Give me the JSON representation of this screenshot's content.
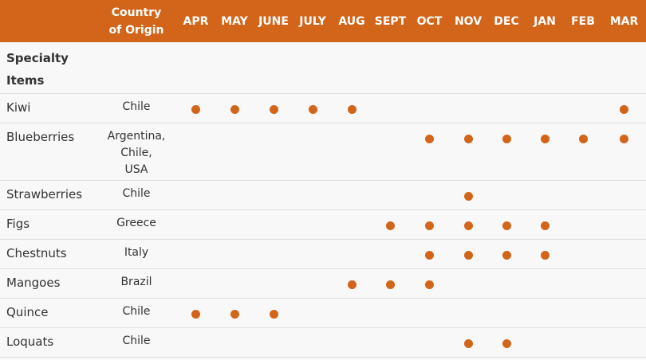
{
  "header": {
    "col1": "",
    "origin_label_line1": "Country",
    "origin_label_line2": "of Origin",
    "months": [
      "APR",
      "MAY",
      "JUNE",
      "JULY",
      "AUG",
      "SEPT",
      "OCT",
      "NOV",
      "DEC",
      "JAN",
      "FEB",
      "MAR"
    ]
  },
  "section": {
    "label_line1": "Specialty",
    "label_line2": "Items"
  },
  "colors": {
    "accent": "#d2651a"
  },
  "rows": [
    {
      "name": "Kiwi",
      "origin": [
        "Chile"
      ],
      "months": [
        "APR",
        "MAY",
        "JUNE",
        "JULY",
        "AUG",
        "MAR"
      ]
    },
    {
      "name": "Blueberries",
      "origin": [
        "Argentina,",
        "Chile,",
        "USA"
      ],
      "months": [
        "OCT",
        "NOV",
        "DEC",
        "JAN",
        "FEB",
        "MAR"
      ]
    },
    {
      "name": "Strawberries",
      "origin": [
        "Chile"
      ],
      "months": [
        "NOV"
      ]
    },
    {
      "name": "Figs",
      "origin": [
        "Greece"
      ],
      "months": [
        "SEPT",
        "OCT",
        "NOV",
        "DEC",
        "JAN"
      ]
    },
    {
      "name": "Chestnuts",
      "origin": [
        "Italy"
      ],
      "months": [
        "OCT",
        "NOV",
        "DEC",
        "JAN"
      ]
    },
    {
      "name": "Mangoes",
      "origin": [
        "Brazil"
      ],
      "months": [
        "AUG",
        "SEPT",
        "OCT"
      ]
    },
    {
      "name": "Quince",
      "origin": [
        "Chile"
      ],
      "months": [
        "APR",
        "MAY",
        "JUNE"
      ]
    },
    {
      "name": "Loquats",
      "origin": [
        "Chile"
      ],
      "months": [
        "NOV",
        "DEC"
      ]
    }
  ]
}
